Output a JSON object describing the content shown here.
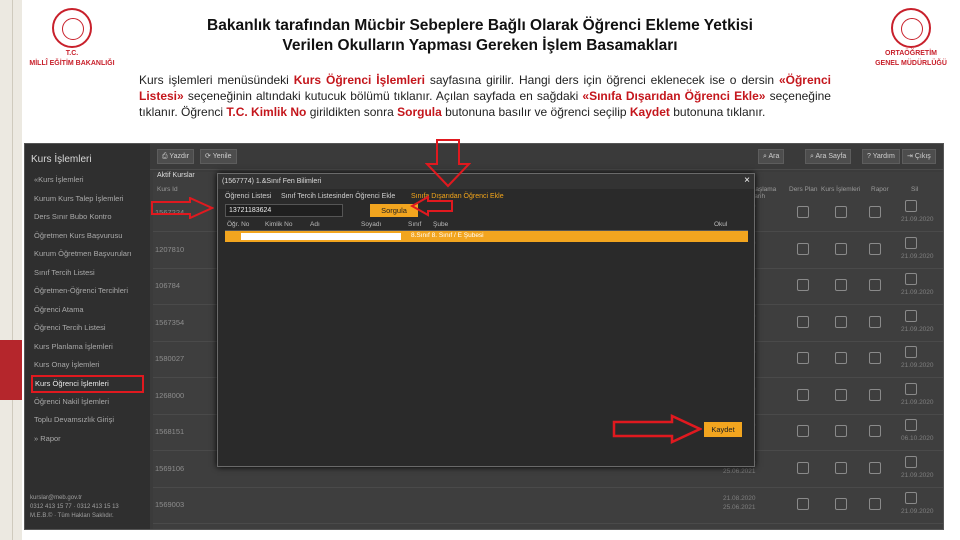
{
  "header": {
    "title_line1": "Bakanlık tarafından Mücbir Sebeplere Bağlı Olarak Öğrenci Ekleme Yetkisi",
    "title_line2": "Verilen Okulların Yapması Gereken İşlem Basamakları",
    "logo_left_line1": "T.C.",
    "logo_left_line2": "MİLLÎ EĞİTİM BAKANLIĞI",
    "logo_right_line1": "ORTAÖĞRETİM",
    "logo_right_line2": "GENEL MÜDÜRLÜĞÜ"
  },
  "description": {
    "p1": "Kurs işlemleri menüsündeki ",
    "r1": "Kurs Öğrenci İşlemleri",
    "p2": " sayfasına girilir. Hangi ders için öğrenci eklenecek ise o dersin ",
    "r2": "«Öğrenci Listesi»",
    "p3": " seçeneğinin altındaki kutucuk bölümü tıklanır. Açılan sayfada en sağdaki ",
    "r3": "«Sınıfa Dışarıdan Öğrenci Ekle»",
    "p4": " seçeneğine tıklanır. Öğrenci ",
    "r4": "T.C. Kimlik No",
    "p5": " girildikten sonra ",
    "r5": "Sorgula",
    "p6": " butonuna basılır ve öğrenci seçilip ",
    "r6": "Kaydet",
    "p7": " butonuna tıklanır."
  },
  "app": {
    "sidebar": {
      "title": "Kurs İşlemleri",
      "items": [
        "«Kurs İşlemleri",
        "Kurum Kurs Talep İşlemleri",
        "Ders Sınır Bubo Kontro",
        "Öğretmen Kurs Başvurusu",
        "Kurum Öğretmen Başvuruları",
        "Sınıf Tercih Listesi",
        "Öğretmen-Öğrenci Tercihleri",
        "Öğrenci Atama",
        "Öğrenci Tercih Listesi",
        "Kurs Planlama İşlemleri",
        "Kurs Onay İşlemleri",
        "Kurs Öğrenci İşlemleri",
        "Öğrenci Nakil İşlemleri",
        "Toplu Devamsızlık Girişi",
        "» Rapor"
      ],
      "highlighted_index": 11,
      "footer_line1": "kurslar@meb.gov.tr",
      "footer_line2": "0312 413 15 77 · 0312 413 15 13",
      "footer_line3": "M.E.B.© · Tüm Hakları Saklıdır."
    },
    "toolbar": {
      "yazdir": "Yazdır",
      "yenile": "Yenile",
      "ara": "Ara",
      "ara_sayfa": "Ara Sayfa",
      "yardim": "Yardım",
      "cikis": "Çıkış"
    },
    "grid": {
      "tab": "Aktif Kurslar",
      "headers": [
        "Kurs Id",
        "Kaşlama Tarih",
        "Ders Plan",
        "Kurs İşlemleri",
        "Rapor",
        "Sil"
      ],
      "rows": [
        {
          "id": "1567224",
          "date1": "21.08.2020",
          "date2": "25.06.2021",
          "date3": "21.09.2020"
        },
        {
          "id": "1207810",
          "date1": "21.08.2020",
          "date2": "25.06.2021",
          "date3": "21.09.2020"
        },
        {
          "id": "106784",
          "date1": "21.08.2020",
          "date2": "25.06.2021",
          "date3": "21.09.2020"
        },
        {
          "id": "1567354",
          "date1": "21.08.2020",
          "date2": "25.06.2021",
          "date3": "21.09.2020"
        },
        {
          "id": "1580027",
          "date1": "21.08.2020",
          "date2": "25.06.2021",
          "date3": "21.09.2020"
        },
        {
          "id": "1268000",
          "date1": "21.08.2020",
          "date2": "25.06.2021",
          "date3": "21.09.2020"
        },
        {
          "id": "1568151",
          "date1": "21.08.2020",
          "date2": "25.06.2021",
          "date3": "06.10.2020"
        },
        {
          "id": "1569106",
          "date1": "21.08.2020",
          "date2": "25.06.2021",
          "date3": "21.09.2020"
        },
        {
          "id": "1569003",
          "date1": "21.08.2020",
          "date2": "25.06.2021",
          "date3": "21.09.2020"
        }
      ]
    },
    "modal": {
      "title": "(1567774) 1.&Sınıf Fen Bilimleri",
      "close": "×",
      "tabs": [
        "Öğrenci Listesi",
        "Sınıf Tercih Listesinden Öğrenci Ekle",
        "Sınıfa Dışarıdan Öğrenci Ekle"
      ],
      "active_tab": 2,
      "tc_input_value": "13721183624",
      "sorgula": "Sorgula",
      "columns": [
        "Öğr. No",
        "Kimlik No",
        "Adı",
        "Soyadı",
        "Sınıf",
        "Şube",
        "Okul"
      ],
      "row_text": "8.Sınıf   8. Sınıf / E Şubesi",
      "kaydet": "Kaydet"
    }
  }
}
